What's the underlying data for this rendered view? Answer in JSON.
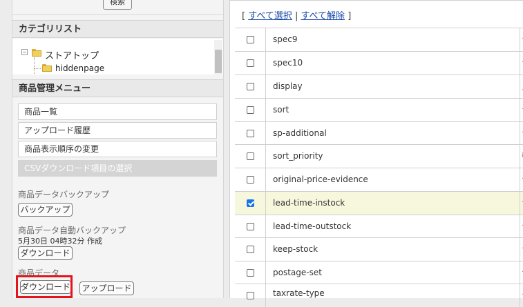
{
  "sidebar": {
    "search_button": "検索",
    "category_title": "カテゴリリスト",
    "tree": [
      {
        "label": "ストアトップ"
      },
      {
        "label": "hiddenpage"
      }
    ],
    "menu_title": "商品管理メニュー",
    "menu_items": [
      {
        "label": "商品一覧"
      },
      {
        "label": "アップロード履歴"
      },
      {
        "label": "商品表示順序の変更"
      },
      {
        "label": "CSVダウンロード項目の選択"
      }
    ],
    "backup_label": "商品データバックアップ",
    "backup_button": "バックアップ",
    "auto_backup_label": "商品データ自動バックアップ",
    "auto_backup_time": "5月30日 04時32分 作成",
    "auto_backup_download": "ダウンロード",
    "product_data_label": "商品データ",
    "download_button": "ダウンロード",
    "upload_button": "アップロード"
  },
  "main": {
    "select_open": "[",
    "select_all": "すべて選択",
    "select_sep": "|",
    "deselect_all": "すべて解除",
    "select_close": "]",
    "rows": [
      {
        "name": "spec9",
        "checked": false,
        "edge": "·"
      },
      {
        "name": "spec10",
        "checked": false,
        "edge": "·"
      },
      {
        "name": "display",
        "checked": false,
        "edge": "ﾉ"
      },
      {
        "name": "sort",
        "checked": false,
        "edge": "·"
      },
      {
        "name": "sp-additional",
        "checked": false,
        "edge": "·"
      },
      {
        "name": "sort_priority",
        "checked": false,
        "edge": "i"
      },
      {
        "name": "original-price-evidence",
        "checked": false,
        "edge": "·"
      },
      {
        "name": "lead-time-instock",
        "checked": true,
        "edge": "·"
      },
      {
        "name": "lead-time-outstock",
        "checked": false,
        "edge": "·"
      },
      {
        "name": "keep-stock",
        "checked": false,
        "edge": "·"
      },
      {
        "name": "postage-set",
        "checked": false,
        "edge": "·"
      },
      {
        "name": "taxrate-type",
        "checked": false,
        "edge": "·"
      }
    ]
  },
  "colors": {
    "highlight_border": "#e3141c",
    "link": "#1a4aa8",
    "checked_row": "#f7f7dd",
    "checkbox_on": "#1a73e8"
  }
}
